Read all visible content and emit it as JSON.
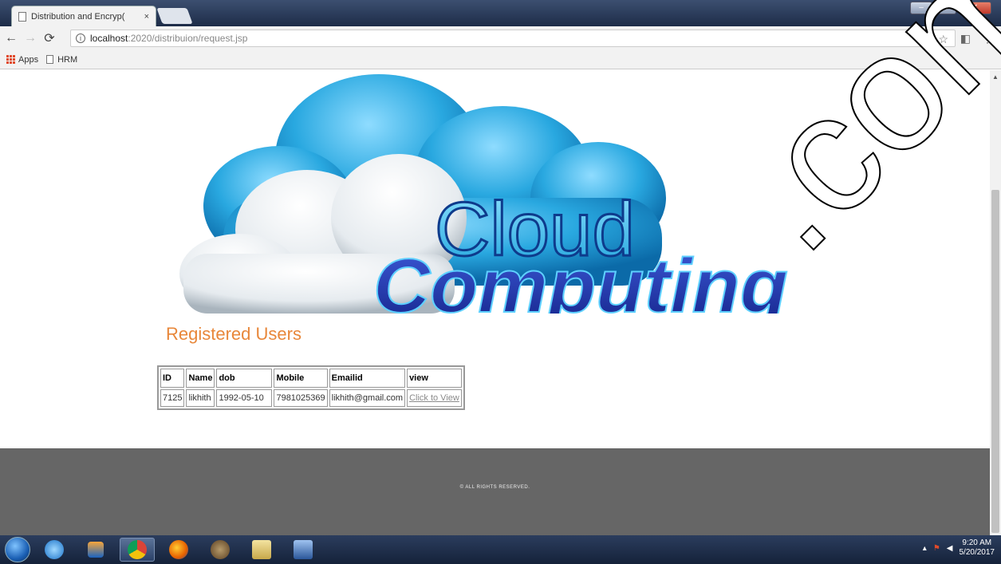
{
  "browser": {
    "tab_title": "Distribution and Encryp(",
    "tab_close": "×",
    "url_host": "localhost",
    "url_path": ":2020/distribuion/request.jsp",
    "bookmarks": [
      {
        "label": "Apps",
        "icon": "apps-grid-icon"
      },
      {
        "label": "HRM",
        "icon": "page-icon"
      }
    ]
  },
  "page": {
    "banner": {
      "line1": "Cloud",
      "line2": "Computing"
    },
    "heading": "Registered Users",
    "table": {
      "headers": [
        "ID",
        "Name",
        "dob",
        "Mobile",
        "Emailid",
        "view"
      ],
      "rows": [
        [
          "7125",
          "likhith",
          "1992-05-10",
          "7981025369",
          "likhith@gmail.com",
          "Click to View"
        ]
      ]
    },
    "footer_text": "© ALL RIGHTS RESERVED.",
    "watermark": ".com"
  },
  "taskbar": {
    "time": "9:20 AM",
    "date": "5/20/2017"
  },
  "colors": {
    "heading": "#e8873a",
    "footer_bg": "#666666",
    "cloud_blue": "#29a8e0"
  }
}
